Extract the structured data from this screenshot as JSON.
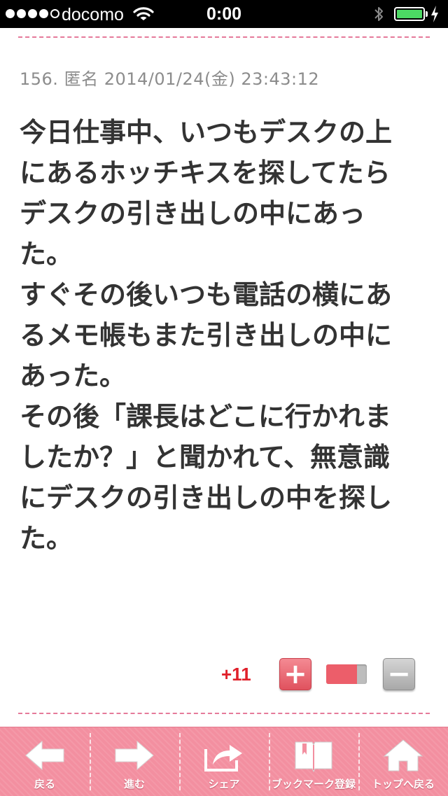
{
  "status_bar": {
    "carrier": "docomo",
    "time": "0:00",
    "signal_bars": 4,
    "battery_level": 1.0
  },
  "post": {
    "meta": "156. 匿名 2014/01/24(金) 23:43:12",
    "body_lines": [
      "今日仕事中、いつもデスクの上",
      "にあるホッチキスを探してたら",
      "デスクの引き出しの中にあっ",
      "た。",
      "すぐその後いつも電話の横にあ",
      "るメモ帳もまた引き出しの中に",
      "あった。",
      "その後「課長はどこに行かれま",
      "したか？」と聞かれて、無意識",
      "にデスクの引き出しの中を探し",
      "た。"
    ]
  },
  "vote": {
    "count": "+11",
    "plus_symbol": "+",
    "minus_symbol": "−",
    "ratio": 0.75
  },
  "toolbar": {
    "back": "戻る",
    "forward": "進む",
    "share": "シェア",
    "bookmark": "ブックマーク登録",
    "top": "トップへ戻る"
  },
  "colors": {
    "accent_pink": "#f38fa0",
    "vote_red": "#e0202a",
    "battery_green": "#4cd964"
  }
}
